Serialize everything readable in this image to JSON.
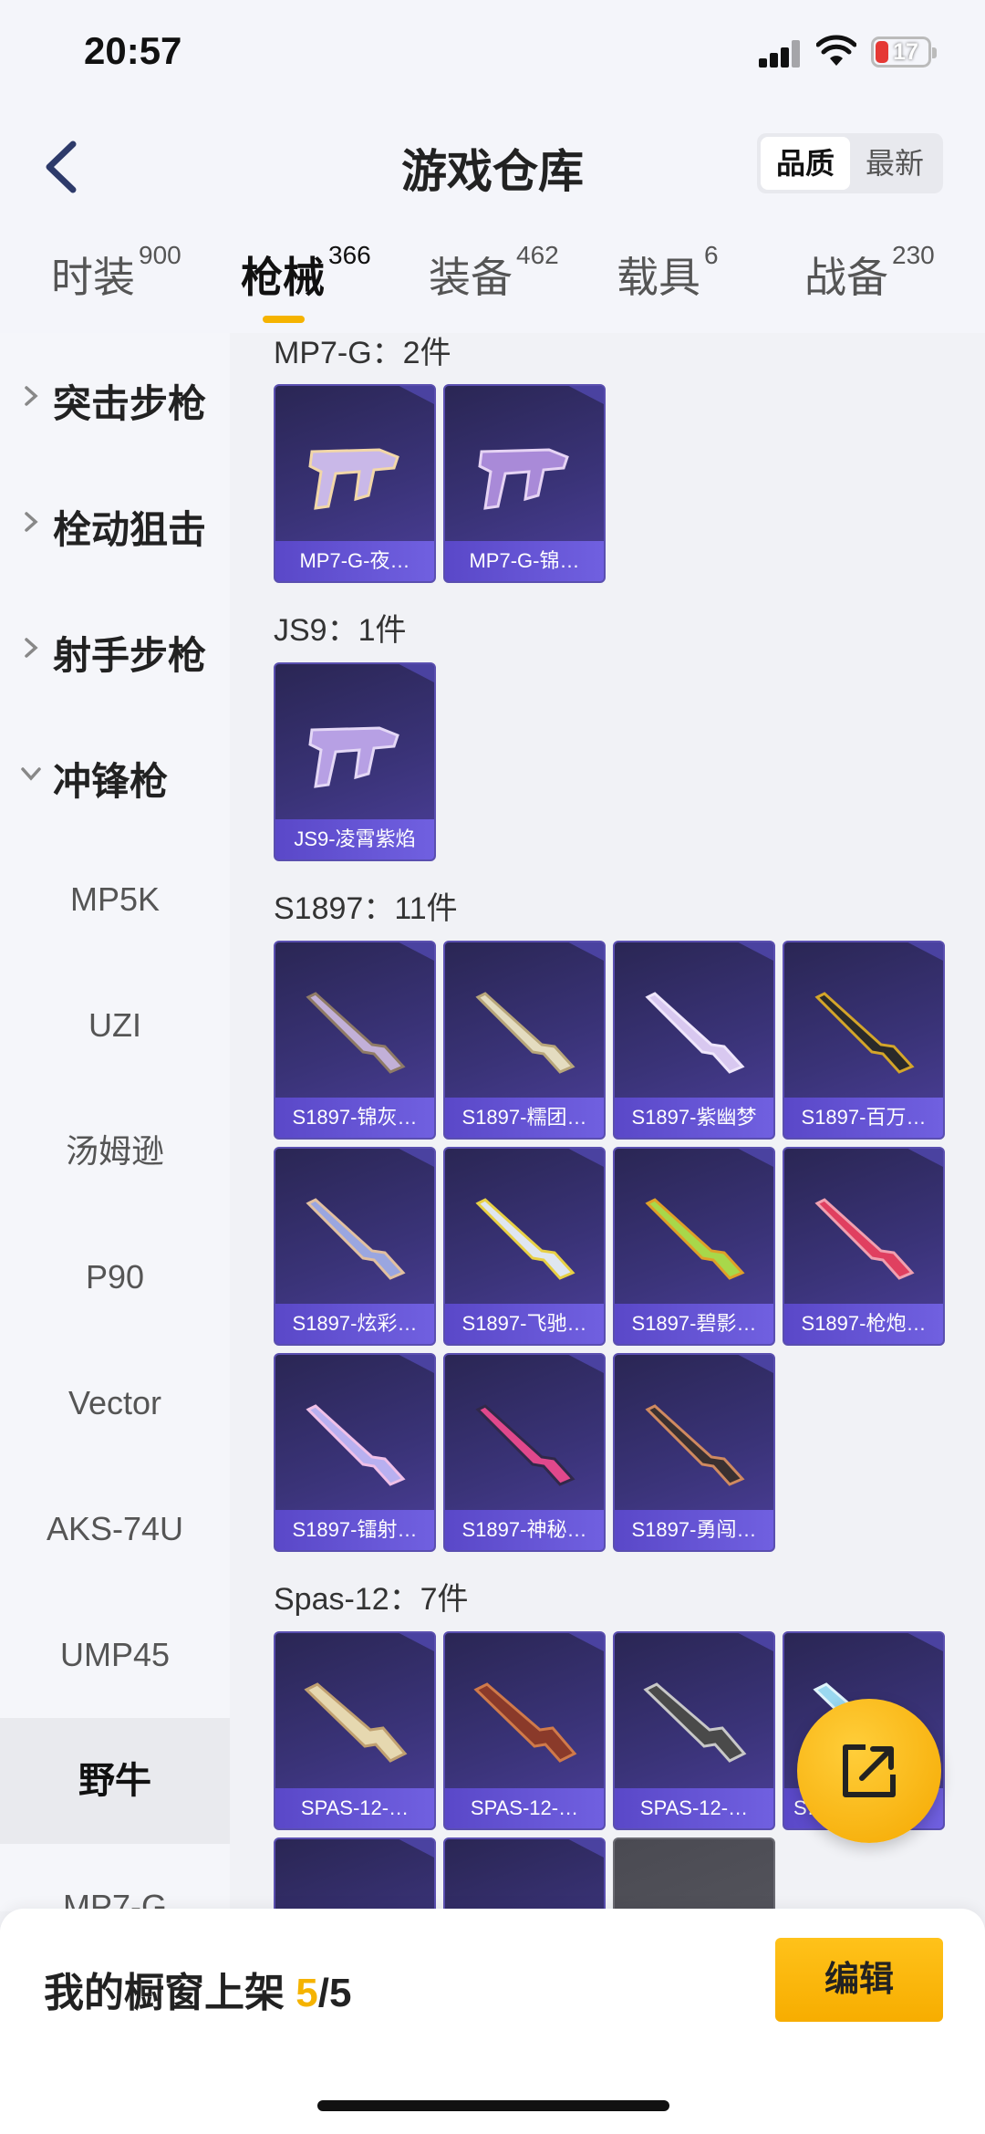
{
  "status_bar": {
    "time": "20:57",
    "battery": "17"
  },
  "header": {
    "title": "游戏仓库",
    "sort_options": [
      "品质",
      "最新"
    ],
    "tabs": [
      {
        "label": "时装",
        "count": "900"
      },
      {
        "label": "枪械",
        "count": "366"
      },
      {
        "label": "装备",
        "count": "462"
      },
      {
        "label": "载具",
        "count": "6"
      },
      {
        "label": "战备",
        "count": "230"
      }
    ]
  },
  "sidebar": {
    "categories": [
      "突击步枪",
      "栓动狙击",
      "射手步枪",
      "冲锋枪"
    ],
    "subitems": [
      "MP5K",
      "UZI",
      "汤姆逊",
      "P90",
      "Vector",
      "AKS-74U",
      "UMP45",
      "野牛",
      "MP7-G"
    ]
  },
  "groups": [
    {
      "title": "MP7-G：2件",
      "items": [
        "MP7-G-夜…",
        "MP7-G-锦…"
      ]
    },
    {
      "title": "JS9：1件",
      "items": [
        "JS9-凌霄紫焰"
      ]
    },
    {
      "title": "S1897：11件",
      "items": [
        "S1897-锦灰…",
        "S1897-糯团…",
        "S1897-紫幽梦",
        "S1897-百万…",
        "S1897-炫彩…",
        "S1897-飞驰…",
        "S1897-碧影…",
        "S1897-枪炮…",
        "S1897-镭射…",
        "S1897-神秘…",
        "S1897-勇闯…"
      ]
    },
    {
      "title": "Spas-12：7件",
      "items": [
        "SPAS-12-…",
        "SPAS-12-…",
        "SPAS-12-…",
        "S…"
      ]
    }
  ],
  "bottom_bar": {
    "showcase_label": "我的橱窗上架 ",
    "showcase_current": "5",
    "showcase_total": "/5",
    "edit_label": "编辑"
  },
  "colors": {
    "accent": "#f5b300",
    "card_bg": "#3a3378",
    "name_bar": "#6a58d8"
  }
}
